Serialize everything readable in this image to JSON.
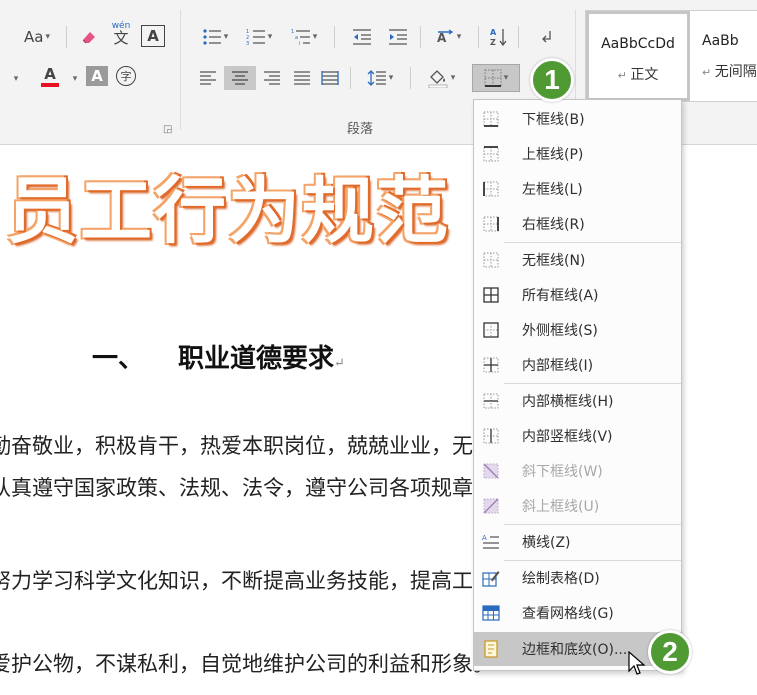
{
  "ribbon": {
    "font": {
      "change_case": "Aa",
      "phonetic_top": "wén",
      "phonetic_bottom": "文",
      "char_border": "A",
      "font_color": "A",
      "char_shading": "A",
      "enclose": "字"
    },
    "paragraph_group_label": "段落",
    "sort_label": "A Z"
  },
  "styles": [
    {
      "preview": "AaBbCcDd",
      "name": "正文",
      "selected": true
    },
    {
      "preview": "AaBb",
      "name": "无间隔",
      "selected": false
    }
  ],
  "document": {
    "title": "员工行为规范",
    "heading_num": "一、",
    "heading": "职业道德要求",
    "lines": [
      "勤奋敬业，积极肯干，热爱本职岗位，兢兢业业，无私奉献。",
      "认真遵守国家政策、法规、法令，遵守公司各项规章制度和劳动纪",
      "努力学习科学文化知识，不断提高业务技能，提高工作效率和提高服",
      "爱护公物，不谋私利，自觉地维护公司的利益和形象。"
    ]
  },
  "border_menu": {
    "items": [
      {
        "label": "下框线(B)",
        "icon": "bottom-border-icon"
      },
      {
        "label": "上框线(P)",
        "icon": "top-border-icon"
      },
      {
        "label": "左框线(L)",
        "icon": "left-border-icon"
      },
      {
        "label": "右框线(R)",
        "icon": "right-border-icon"
      },
      {
        "label": "无框线(N)",
        "icon": "no-border-icon"
      },
      {
        "label": "所有框线(A)",
        "icon": "all-borders-icon"
      },
      {
        "label": "外侧框线(S)",
        "icon": "outside-borders-icon"
      },
      {
        "label": "内部框线(I)",
        "icon": "inside-borders-icon"
      },
      {
        "label": "内部横框线(H)",
        "icon": "inside-horizontal-border-icon"
      },
      {
        "label": "内部竖框线(V)",
        "icon": "inside-vertical-border-icon"
      },
      {
        "label": "斜下框线(W)",
        "icon": "diagonal-down-border-icon",
        "disabled": true
      },
      {
        "label": "斜上框线(U)",
        "icon": "diagonal-up-border-icon",
        "disabled": true
      },
      {
        "label": "横线(Z)",
        "icon": "horizontal-line-icon"
      },
      {
        "label": "绘制表格(D)",
        "icon": "draw-table-icon"
      },
      {
        "label": "查看网格线(G)",
        "icon": "view-gridlines-icon"
      },
      {
        "label": "边框和底纹(O)...",
        "icon": "borders-shading-icon",
        "hover": true
      }
    ]
  },
  "callouts": {
    "step1": "1",
    "step2": "2"
  },
  "colors": {
    "accent_orange": "#e26b2b",
    "callout_green": "#4f9a32",
    "font_color_red": "#e81123"
  }
}
